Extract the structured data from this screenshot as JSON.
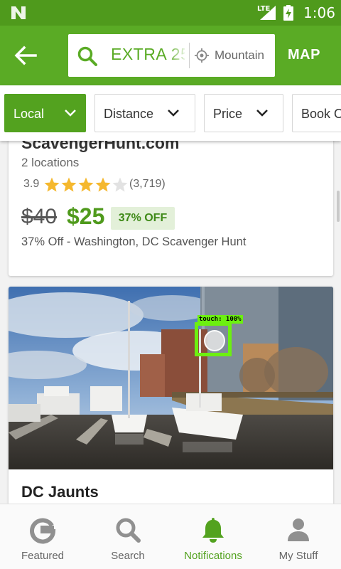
{
  "status_bar": {
    "network": "LTE",
    "time": "1:06"
  },
  "top_bar": {
    "search_query": "EXTRA 25",
    "location": "Mountain",
    "map_label": "MAP"
  },
  "filters": [
    {
      "label": "Local",
      "active": true
    },
    {
      "label": "Distance",
      "active": false
    },
    {
      "label": "Price",
      "active": false
    },
    {
      "label": "Book O",
      "active": false
    }
  ],
  "deals": [
    {
      "title": "ScavengerHunt.com",
      "locations": "2 locations",
      "rating": "3.9",
      "stars": 3.9,
      "reviews": "(3,719)",
      "original_price": "$40",
      "sale_price": "$25",
      "discount": "37% OFF",
      "description": "37% Off - Washington, DC Scavenger Hunt"
    },
    {
      "title": "DC Jaunts"
    }
  ],
  "touch_overlay": {
    "label": "touch: 100%"
  },
  "bottom_nav": [
    {
      "label": "Featured",
      "icon": "groupon-g-icon",
      "active": false
    },
    {
      "label": "Search",
      "icon": "search-icon",
      "active": false
    },
    {
      "label": "Notifications",
      "icon": "bell-icon",
      "active": true
    },
    {
      "label": "My Stuff",
      "icon": "person-icon",
      "active": false
    }
  ],
  "colors": {
    "brand_green": "#5aab25",
    "status_green": "#4f9a1c",
    "touch_green": "#6cf010"
  }
}
